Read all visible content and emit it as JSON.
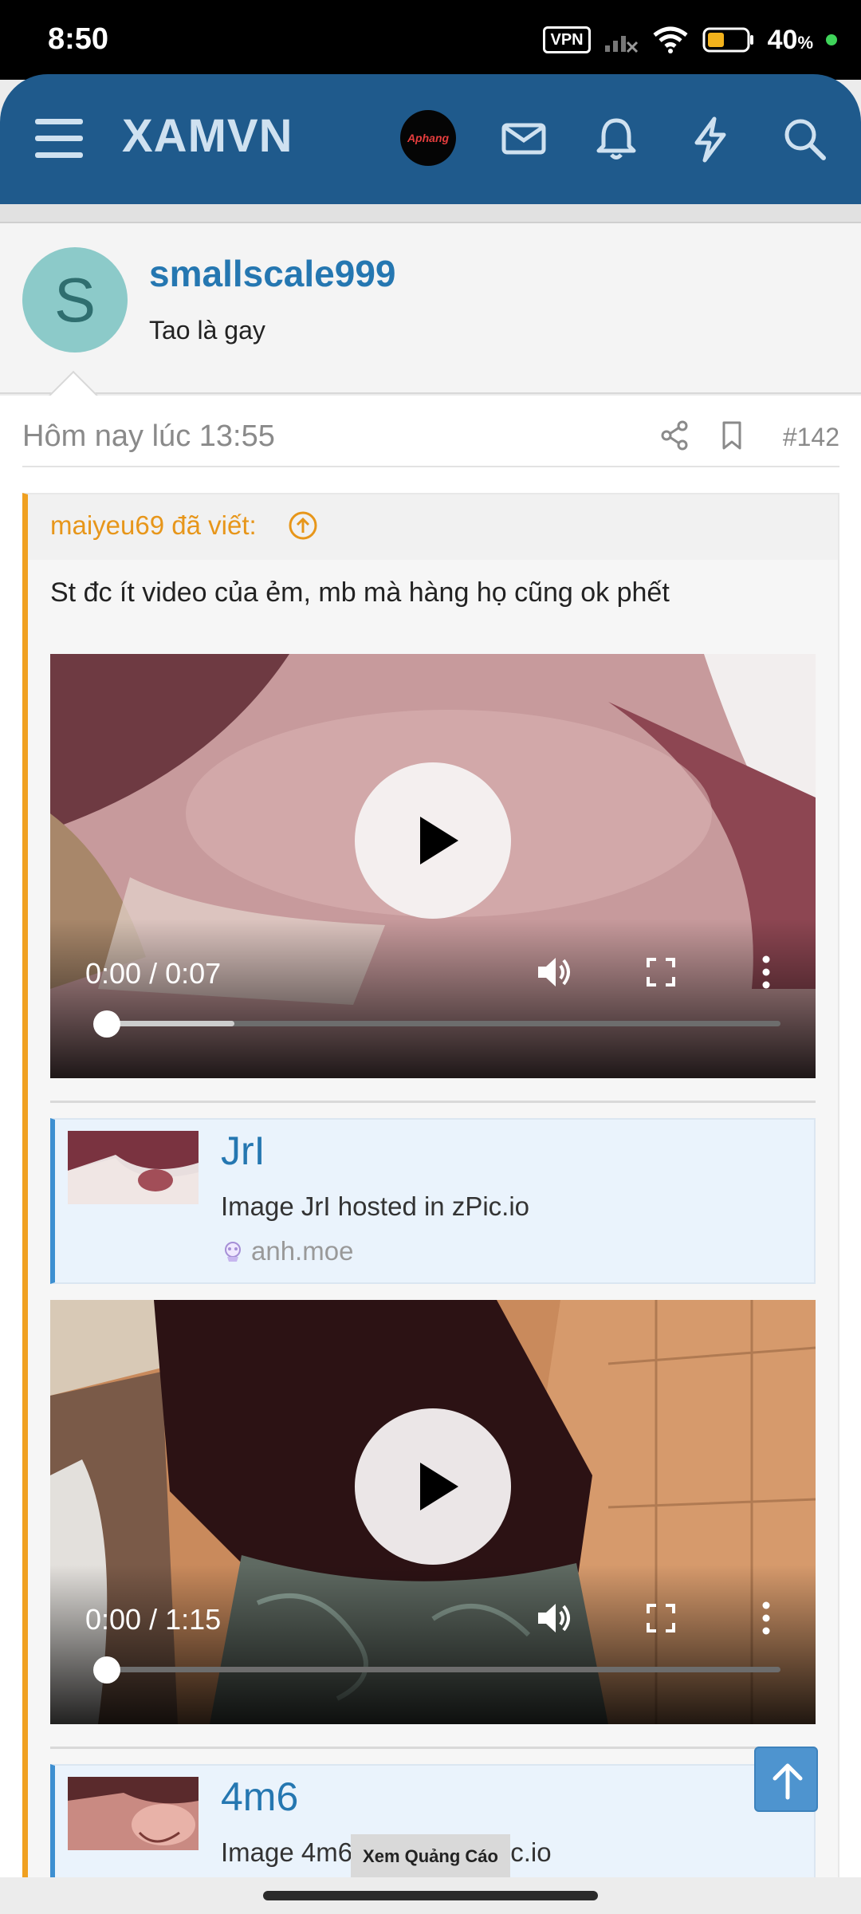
{
  "status_bar": {
    "time": "8:50",
    "vpn": "VPN",
    "battery": "40",
    "battery_unit": "%"
  },
  "header": {
    "brand": "XAMVN",
    "avatar_text": "Aphang",
    "icons": [
      "menu-icon",
      "avatar",
      "mail-icon",
      "bell-icon",
      "lightning-icon",
      "search-icon"
    ]
  },
  "user": {
    "initial": "S",
    "username": "smallscale999",
    "title": "Tao là gay"
  },
  "post": {
    "date": "Hôm nay lúc 13:55",
    "number": "#142",
    "quote": {
      "author": "maiyeu69 đã viết:",
      "text": "St đc ít video của ẻm, mb mà hàng họ cũng ok phết"
    },
    "videos": [
      {
        "time": "0:00 / 0:07",
        "buffered": 0.2
      },
      {
        "time": "0:00 / 1:15",
        "buffered": 0.0
      }
    ],
    "embeds": [
      {
        "title": "JrI",
        "description": "Image JrI hosted in zPic.io",
        "site": "anh.moe"
      },
      {
        "title": "4m6",
        "description": "Image 4m6 hosted in zPic.io"
      }
    ]
  },
  "ad_button": "Xem Quảng Cáo",
  "colors": {
    "header": "#1f5a8c",
    "link": "#2577b1",
    "quote_accent": "#f0a020"
  }
}
